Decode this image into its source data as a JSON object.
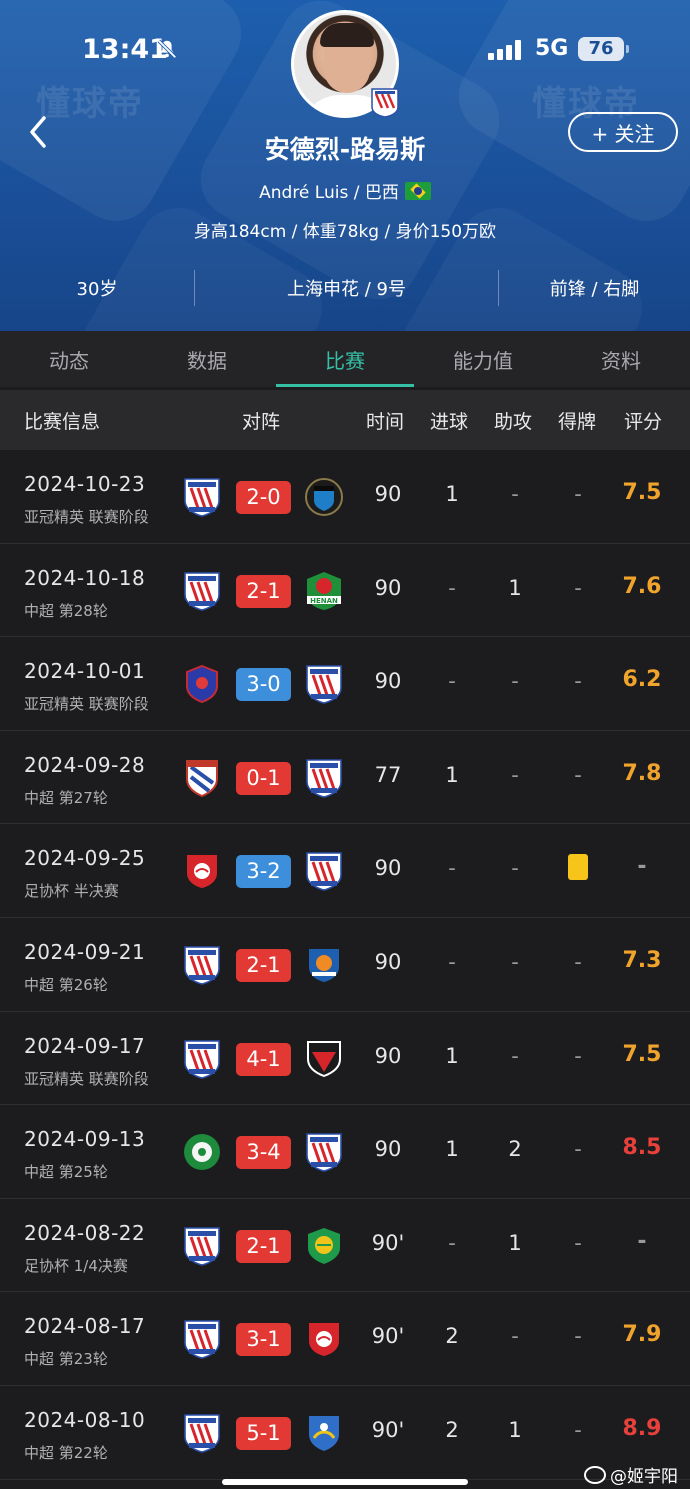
{
  "status_bar": {
    "time": "13:41",
    "network": "5G",
    "battery": "76"
  },
  "header": {
    "watermark": "懂球帝",
    "name": "安德烈-路易斯",
    "subtitle": "André Luis / 巴西",
    "stats": "身高184cm / 体重78kg / 身价150万欧",
    "follow_label": "+ 关注",
    "info": [
      "30岁",
      "上海申花 / 9号",
      "前锋 / 右脚"
    ]
  },
  "tabs": [
    "动态",
    "数据",
    "比赛",
    "能力值",
    "资料"
  ],
  "active_tab": 2,
  "table_header": {
    "info": "比赛信息",
    "lineup": "对阵",
    "time": "时间",
    "goals": "进球",
    "assists": "助攻",
    "cards": "得牌",
    "rating": "评分"
  },
  "colors": {
    "accent": "#35c0a6",
    "loss_or_draw_score": "#3d8fdc",
    "win_score": "#e23935",
    "rating_orange": "#f0a42c",
    "rating_red": "#e8403a"
  },
  "matches": [
    {
      "date": "2024-10-23",
      "comp": "亚冠精英 联赛阶段",
      "home": "shenhua-logo",
      "away": "kawasaki-logo",
      "score": "2-0",
      "score_color": "red",
      "minutes": "90",
      "goals": "1",
      "assists": "-",
      "cards": "-",
      "rating": "7.5",
      "rating_color": "orange"
    },
    {
      "date": "2024-10-18",
      "comp": "中超 第28轮",
      "home": "shenhua-logo",
      "away": "henan-logo",
      "score": "2-1",
      "score_color": "red",
      "minutes": "90",
      "goals": "-",
      "assists": "1",
      "cards": "-",
      "rating": "7.6",
      "rating_color": "orange"
    },
    {
      "date": "2024-10-01",
      "comp": "亚冠精英 联赛阶段",
      "home": "johor-logo",
      "away": "shenhua-logo",
      "score": "3-0",
      "score_color": "blue",
      "minutes": "90",
      "goals": "-",
      "assists": "-",
      "cards": "-",
      "rating": "6.2",
      "rating_color": "orange"
    },
    {
      "date": "2024-09-28",
      "comp": "中超 第27轮",
      "home": "meizhou-logo",
      "away": "shenhua-logo",
      "score": "0-1",
      "score_color": "red",
      "minutes": "77",
      "goals": "1",
      "assists": "-",
      "cards": "-",
      "rating": "7.8",
      "rating_color": "orange"
    },
    {
      "date": "2024-09-25",
      "comp": "足协杯 半决赛",
      "home": "shanghai-port-logo",
      "away": "shenhua-logo",
      "score": "3-2",
      "score_color": "blue",
      "minutes": "90",
      "goals": "-",
      "assists": "-",
      "cards": "yellow",
      "rating": "-",
      "rating_color": "dash"
    },
    {
      "date": "2024-09-21",
      "comp": "中超 第26轮",
      "home": "shenhua-logo",
      "away": "shenzhen-logo",
      "score": "2-1",
      "score_color": "red",
      "minutes": "90",
      "goals": "-",
      "assists": "-",
      "cards": "-",
      "rating": "7.3",
      "rating_color": "orange"
    },
    {
      "date": "2024-09-17",
      "comp": "亚冠精英 联赛阶段",
      "home": "shenhua-logo",
      "away": "pohang-logo",
      "score": "4-1",
      "score_color": "red",
      "minutes": "90",
      "goals": "1",
      "assists": "-",
      "cards": "-",
      "rating": "7.5",
      "rating_color": "orange"
    },
    {
      "date": "2024-09-13",
      "comp": "中超 第25轮",
      "home": "zhejiang-logo",
      "away": "shenhua-logo",
      "score": "3-4",
      "score_color": "red",
      "minutes": "90",
      "goals": "1",
      "assists": "2",
      "cards": "-",
      "rating": "8.5",
      "rating_color": "red"
    },
    {
      "date": "2024-08-22",
      "comp": "足协杯 1/4决赛",
      "home": "shenhua-logo",
      "away": "guoan-logo",
      "score": "2-1",
      "score_color": "red",
      "minutes": "90'",
      "goals": "-",
      "assists": "1",
      "cards": "-",
      "rating": "-",
      "rating_color": "dash"
    },
    {
      "date": "2024-08-17",
      "comp": "中超 第23轮",
      "home": "shenhua-logo",
      "away": "shanghai-port-logo",
      "score": "3-1",
      "score_color": "red",
      "minutes": "90'",
      "goals": "2",
      "assists": "-",
      "cards": "-",
      "rating": "7.9",
      "rating_color": "orange"
    },
    {
      "date": "2024-08-10",
      "comp": "中超 第22轮",
      "home": "shenhua-logo",
      "away": "nantong-logo",
      "score": "5-1",
      "score_color": "red",
      "minutes": "90'",
      "goals": "2",
      "assists": "1",
      "cards": "-",
      "rating": "8.9",
      "rating_color": "red"
    }
  ],
  "footer": {
    "weibo_handle": "@姬宇阳"
  }
}
